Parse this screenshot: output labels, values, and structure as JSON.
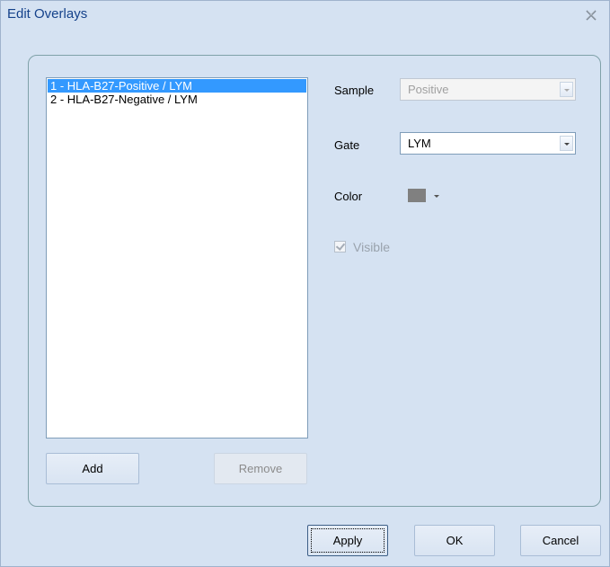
{
  "window": {
    "title": "Edit Overlays"
  },
  "overlay_list": {
    "items": [
      {
        "label": "1 - HLA-B27-Positive / LYM",
        "selected": true
      },
      {
        "label": "2 - HLA-B27-Negative / LYM",
        "selected": false
      }
    ]
  },
  "form": {
    "sample_label": "Sample",
    "sample_value": "Positive",
    "gate_label": "Gate",
    "gate_value": "LYM",
    "color_label": "Color",
    "color_value": "#808080",
    "visible_label": "Visible",
    "visible_checked": true
  },
  "buttons": {
    "add": "Add",
    "remove": "Remove",
    "apply": "Apply",
    "ok": "OK",
    "cancel": "Cancel"
  },
  "theme": {
    "background": "#d5e2f2",
    "title_color": "#15428b",
    "selection": "#3399ff"
  }
}
